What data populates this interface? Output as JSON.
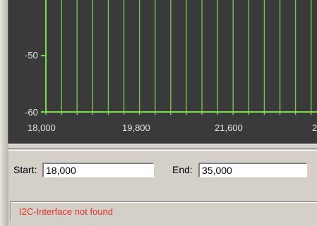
{
  "chart_data": {
    "type": "line",
    "y_ticks": [
      "-50",
      "-60"
    ],
    "x_ticks": [
      "18,000",
      "19,800",
      "21,600",
      "2"
    ],
    "x_start": 18000,
    "x_visible_end": 23400,
    "line_color": "#7ddc4a",
    "background": "#3a3a3a",
    "grid": true
  },
  "range": {
    "start_label": "Start:",
    "start_value": "18,000",
    "end_label": "End:",
    "end_value": "35,000"
  },
  "status": {
    "message": "I2C-Interface not found",
    "color": "#e0302a"
  }
}
